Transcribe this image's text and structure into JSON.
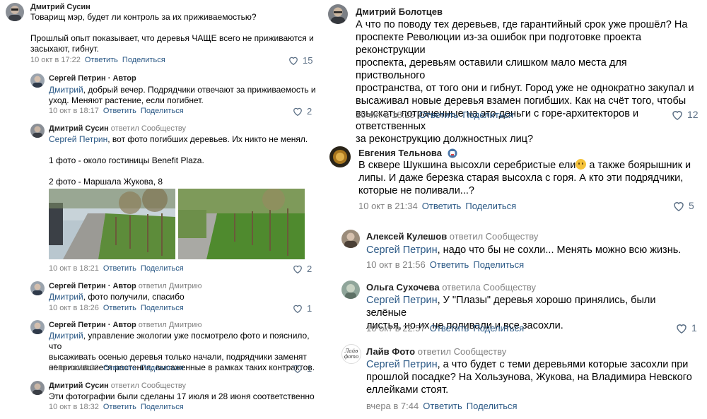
{
  "left": {
    "c1": {
      "author": "Дмитрий Сусин",
      "lines": [
        "Товарищ мэр, будет ли контроль за их приживаемостью?",
        "",
        "Прошлый опыт показывает, что деревья ЧАЩЕ всего не приживаются и",
        "засыхают, гибнут."
      ],
      "time": "10 окт в 17:22",
      "reply": "Ответить",
      "share": "Поделиться",
      "likes": "15"
    },
    "c2": {
      "author": "Сергей Петрин",
      "author_suffix": " · Автор",
      "mention": "Дмитрий",
      "lines": [
        ", добрый вечер. Подрядчики отвечают за приживаемость и",
        "уход. Меняют растение, если погибнет."
      ],
      "time": "10 окт в 18:17",
      "reply": "Ответить",
      "share": "Поделиться",
      "likes": "2"
    },
    "c3": {
      "author": "Дмитрий Сусин",
      "replied": " ответил Сообществу",
      "mention": "Сергей Петрин",
      "lines": [
        ", вот фото погибших деревьев. Их никто не менял.",
        "",
        "1 фото - около гостиницы Benefit Plaza.",
        "",
        "2 фото - Маршала Жукова, 8"
      ],
      "time": "10 окт в 18:21",
      "reply": "Ответить",
      "share": "Поделиться",
      "likes": "2"
    },
    "c4": {
      "author": "Сергей Петрин",
      "author_suffix": " · Автор",
      "replied": " ответил Дмитрию",
      "mention": "Дмитрий",
      "lines": [
        ", фото получили, спасибо"
      ],
      "time": "10 окт в 18:26",
      "reply": "Ответить",
      "share": "Поделиться",
      "likes": "1"
    },
    "c5": {
      "author": "Сергей Петрин",
      "author_suffix": " · Автор",
      "replied": " ответил Дмитрию",
      "mention": "Дмитрий",
      "lines": [
        ", управление экологии уже посмотрело фото и пояснило, что",
        "высаживать осенью деревья только начали, подрядчики заменят",
        "неприжившиеся растения, высаженные в рамках таких контрактов."
      ],
      "time": "10 окт в 18:30",
      "reply": "Ответить",
      "share": "Поделиться",
      "likes": "1"
    },
    "c6": {
      "author": "Дмитрий Сусин",
      "replied": " ответил Сообществу",
      "lines": [
        "Эти фотографии были сделаны 17 июля и 28 июня соответственно"
      ],
      "time": "10 окт в 18:32",
      "reply": "Ответить",
      "share": "Поделиться"
    }
  },
  "right": {
    "r1": {
      "author": "Дмитрий Болотцев",
      "lines": [
        "А что по поводу тех деревьев, где гарантийный срок уже прошёл? На",
        "проспекте Революции из-за ошибок при подготовке проекта реконструкции",
        "проспекта, деревьям оставили слишком мало места для приствольного",
        "пространства, от того они и гибнут. Город уже не однократно закупал и",
        "высаживал новые деревья взамен погибших. Как на счёт того, чтобы",
        "взыскать потраченные на это деньги с горе-архитекторов и ответственных",
        "за реконструкцию должностных лиц?"
      ],
      "time": "10 окт в 18:25",
      "reply": "Ответить",
      "share": "Поделиться",
      "likes": "12"
    },
    "r2": {
      "author": "Евгения Тельнова",
      "line1_a": "В сквере Шукшина высохли серебристые ели",
      "line1_b": " а также боярышник и",
      "lines": [
        "липы. И даже березка старая высохла с горя. А кто эти подрядчики,",
        "которые не поливали...?"
      ],
      "time": "10 окт в 21:34",
      "reply": "Ответить",
      "share": "Поделиться",
      "likes": "5"
    },
    "r3": {
      "author": "Алексей Кулешов",
      "replied": " ответил Сообществу",
      "mention": "Сергей Петрин",
      "lines": [
        ", надо что бы не сохли... Менять можно всю жизнь."
      ],
      "time": "10 окт в 21:56",
      "reply": "Ответить",
      "share": "Поделиться"
    },
    "r4": {
      "author": "Ольга Сухочева",
      "replied": " ответила Сообществу",
      "mention": "Сергей Петрин",
      "lines": [
        ", У \"Плазы\" деревья хорошо принялись, были зелёные",
        "листья, но их не поливали и все засохли."
      ],
      "time": "10 окт в 22:57",
      "reply": "Ответить",
      "share": "Поделиться",
      "likes": "1"
    },
    "r5": {
      "author": "Лайв Фото",
      "replied": " ответил Сообществу",
      "logo_text": "Лайв фото",
      "mention": "Сергей Петрин",
      "lines": [
        ", а что будет с теми деревьями которые засохли при",
        "прошлой посадке? На Хользунова, Жукова, на Владимира Невского",
        "еллейками стоят."
      ],
      "time": "вчера в 7:44",
      "reply": "Ответить",
      "share": "Поделиться"
    }
  },
  "colors": {
    "link": "#2a5885",
    "muted": "#828282",
    "like": "#5b6f85"
  }
}
